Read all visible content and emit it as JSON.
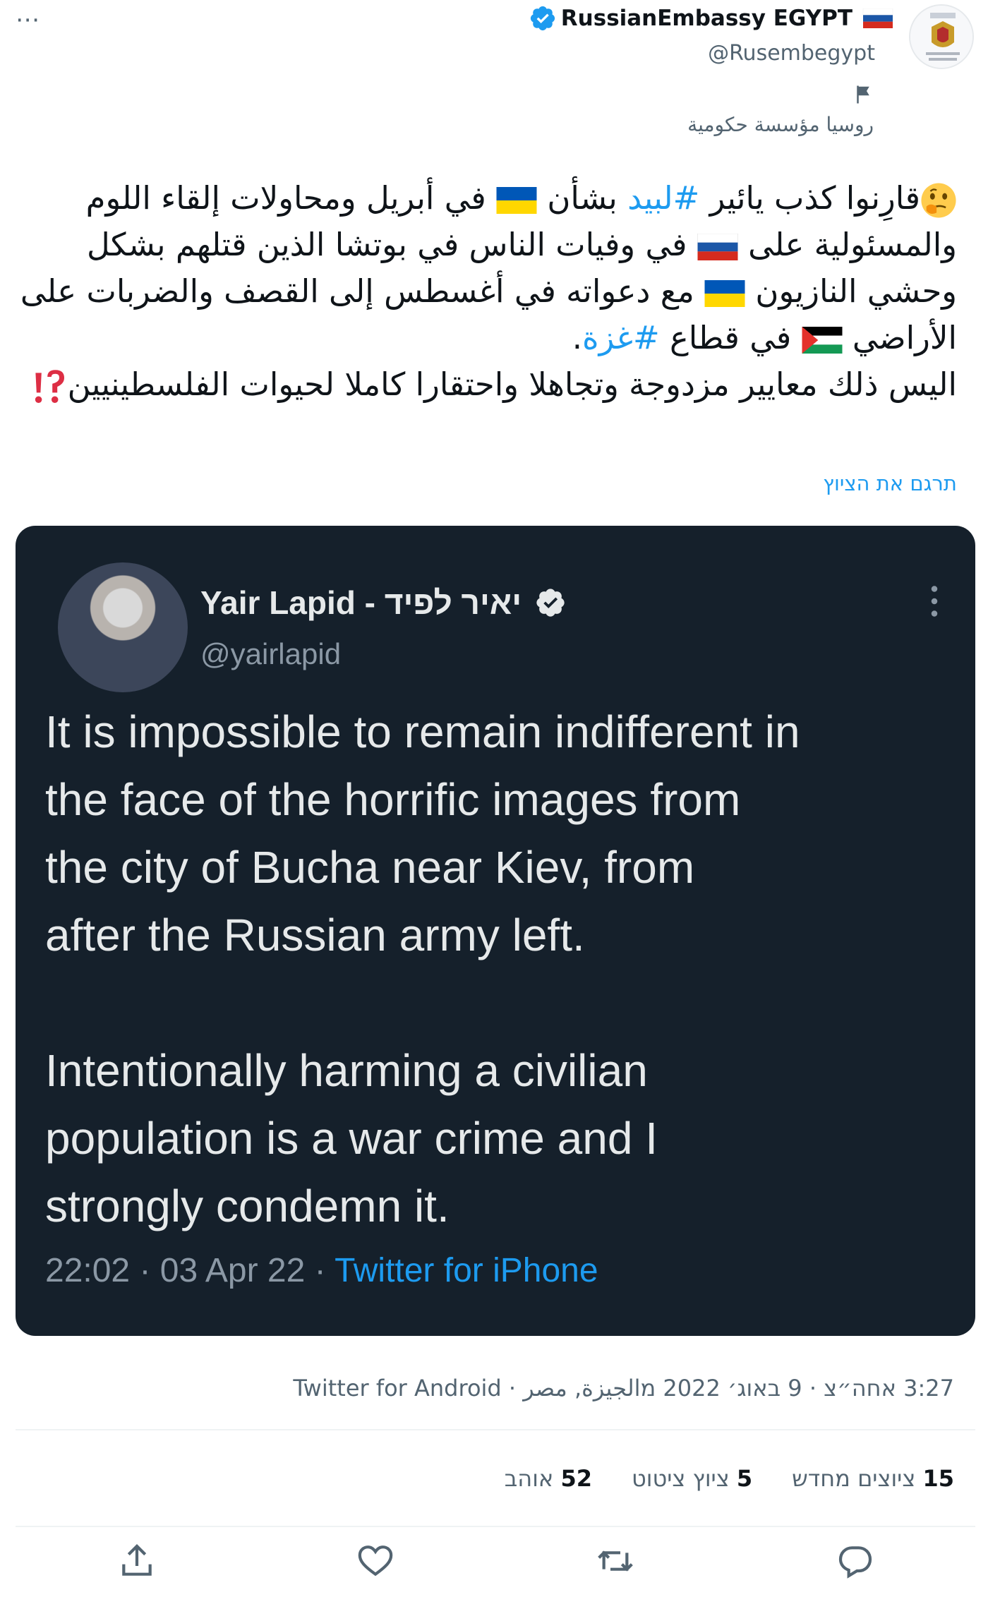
{
  "header": {
    "display_name": "RussianEmbassy EGYPT",
    "handle": "@Rusembegypt",
    "account_label": "روسيا مؤسسة حكومية"
  },
  "tweet": {
    "line1_a": "قارِنوا كذب يائير ",
    "hashtag_lapid": "#لبيد",
    "line1_b": " بشأن ",
    "line1_c": " في أبريل ومحاولات إلقاء اللوم والمسئولية على ",
    "line1_d": " في وفيات الناس في بوتشا الذين قتلهم بشكل وحشي النازيون ",
    "line1_e": " مع دعواته في أغسطس إلى القصف والضربات على الأراضي ",
    "line1_f": " في قطاع ",
    "hashtag_gaza": "#غزة",
    "line1_g": ".",
    "line2": "اليس ذلك معايير مزدوجة وتجاهلا واحتقارا كاملا لحيوات الفلسطينيين",
    "translate_label": "תרגם את הציוץ"
  },
  "embedded": {
    "display_name": "Yair Lapid - יאיר לפיד",
    "handle": "@yairlapid",
    "text": "It is impossible to remain indifferent in\nthe face of the horrific images from\nthe city of Bucha near Kiev, from\nafter the Russian army left.\n\nIntentionally harming a civilian\npopulation is a war crime and I\nstrongly condemn it.",
    "meta": "22:02 · 03 Apr 22 · ",
    "source": "Twitter for iPhone"
  },
  "meta_line": "3:27 אחה״צ · 9 באוג׳ 2022 מ‏الجيزة, مصر · Twitter for Android",
  "stats": {
    "retweets_count": "15",
    "retweets_label": "ציוצים מחדש",
    "quotes_count": "5",
    "quotes_label": "ציוץ ציטוט",
    "likes_count": "52",
    "likes_label": "אוהב"
  },
  "colors": {
    "accent": "#1d9bf0",
    "embedded_bg": "#15202b",
    "secondary_text": "#536471"
  },
  "icons": [
    "more-icon",
    "verified-icon",
    "russia-flag-icon",
    "label-flag-icon",
    "ukraine-flag-icon",
    "palestine-flag-icon",
    "thinking-emoji-icon",
    "interrobang-icon",
    "reply-icon",
    "retweet-icon",
    "like-icon",
    "share-icon"
  ]
}
